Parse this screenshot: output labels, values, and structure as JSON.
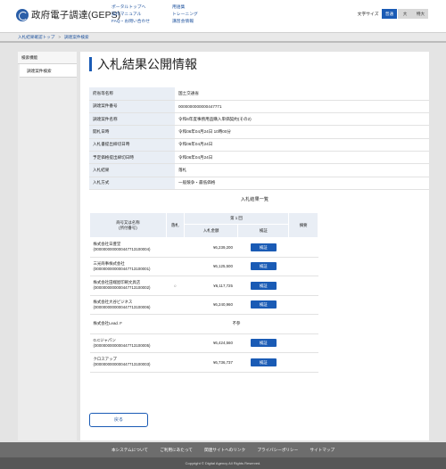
{
  "header": {
    "logo_text": "政府電子調達(GEPS)",
    "nav_col1": [
      "ポータルトップへ",
      "操作マニュアル",
      "FAQ・お問い合わせ"
    ],
    "nav_col2": [
      "用語集",
      "トレーニング",
      "講習会情報"
    ],
    "font_size_label": "文字サイズ",
    "font_sizes": [
      "普通",
      "大",
      "特大"
    ]
  },
  "breadcrumb": [
    "入札結果確認トップ",
    "調達案件検索"
  ],
  "sidebar": {
    "title": "検索機能",
    "items": [
      "調達案件検索"
    ]
  },
  "page_title": "入札結果公開情報",
  "info_rows": [
    {
      "key": "府省等名称",
      "value": "国土交通省"
    },
    {
      "key": "調達案件番号",
      "value": "0000000000000447771"
    },
    {
      "key": "調達案件名称",
      "value": "令和6年度事務用品購入単価契約(その2)"
    },
    {
      "key": "開札日時",
      "value": "令和06年04月24日 10時00分"
    },
    {
      "key": "入札書提出締切日時",
      "value": "令和06年04月24日"
    },
    {
      "key": "予定価格提出締切日時",
      "value": "令和06年04月24日"
    },
    {
      "key": "入札結果",
      "value": "落札"
    },
    {
      "key": "入札方式",
      "value": "一般競争・最低価格"
    }
  ],
  "results": {
    "caption": "入札結果一覧",
    "headers": {
      "name": "商号又は名称\n(所付番号)",
      "award": "落札",
      "round": "第 1 回",
      "amount": "入札金額",
      "verify": "検証",
      "remarks": "摘要"
    },
    "verify_label": "検証",
    "rows": [
      {
        "name": "株式会社日豊堂",
        "id": "(0000000000000447713100004)",
        "award": "",
        "amount": "¥6,239,200",
        "verify": true
      },
      {
        "name": "三光商事株式会社",
        "id": "(0000000000000447713100001)",
        "award": "",
        "amount": "¥6,125,500",
        "verify": true
      },
      {
        "name": "株式会社田端屋印刷文具店",
        "id": "(0000000000000447713100002)",
        "award": "○",
        "amount": "¥6,117,725",
        "verify": true
      },
      {
        "name": "株式会社大谷ビジネス",
        "id": "(0000000000000447713100006)",
        "award": "",
        "amount": "¥6,240,960",
        "verify": true
      },
      {
        "name": "株式会社Lead. F",
        "id": "",
        "award": "",
        "amount": "不参",
        "verify": false
      },
      {
        "name": "G.Cジャパン",
        "id": "(0000000000000447713100005)",
        "award": "",
        "amount": "¥6,424,560",
        "verify": true
      },
      {
        "name": "クロスアップ",
        "id": "(0000000000000447713100003)",
        "award": "",
        "amount": "¥6,736,737",
        "verify": true
      }
    ]
  },
  "back_label": "戻る",
  "footer": {
    "links": [
      "本システムについて",
      "ご利用にあたって",
      "関連サイトへのリンク",
      "プライバシーポリシー",
      "サイトマップ"
    ],
    "copyright": "Copyright © Digital Agency All Rights Reserved."
  }
}
